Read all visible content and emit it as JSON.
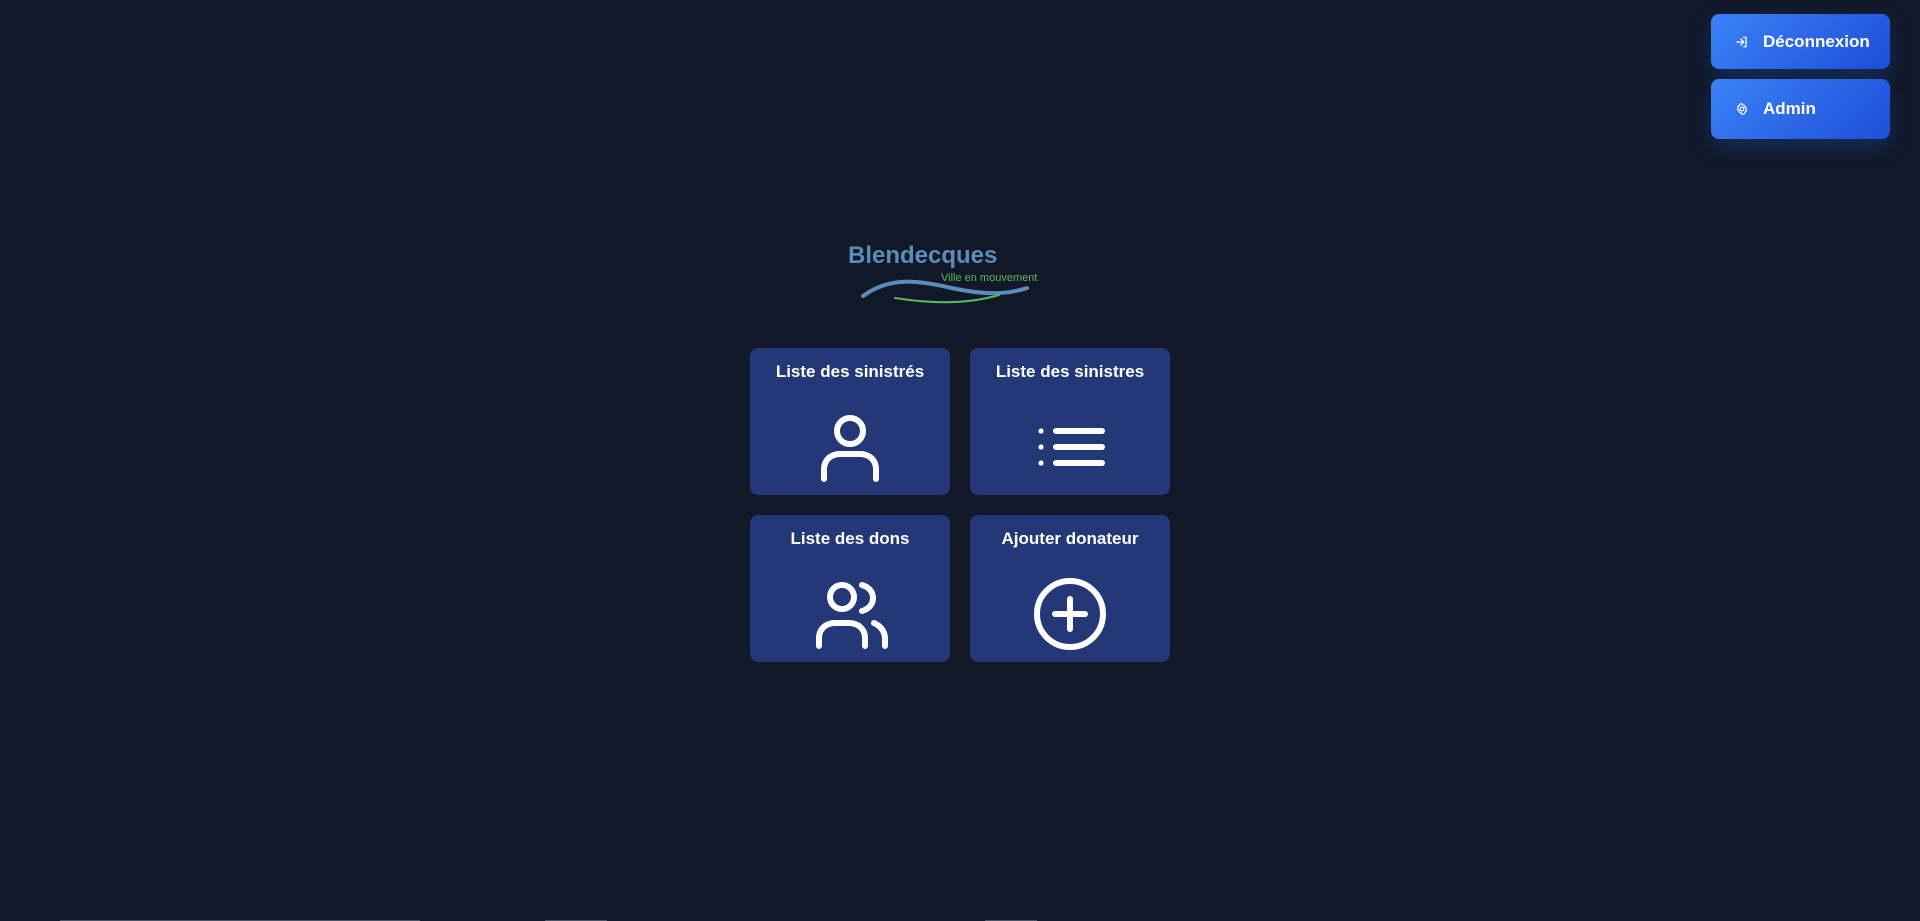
{
  "header": {
    "logout_label": "Déconnexion",
    "admin_label": "Admin",
    "logout_icon": "logout-icon",
    "admin_icon": "gear-icon"
  },
  "logo": {
    "title": "Blendecques",
    "subtitle": "Ville en mouvement",
    "title_color": "#5b8db8",
    "subtitle_color": "#5cb85c"
  },
  "menu": {
    "cards": [
      {
        "label": "Liste des sinistrés",
        "icon": "user-icon"
      },
      {
        "label": "Liste des sinistres",
        "icon": "list-icon"
      },
      {
        "label": "Liste des dons",
        "icon": "users-icon"
      },
      {
        "label": "Ajouter donateur",
        "icon": "plus-circle-icon"
      }
    ]
  },
  "theme": {
    "background": "#111827",
    "card_background": "#243878",
    "button_primary": "#3b82f6",
    "button_secondary": "#1d4ed8"
  }
}
